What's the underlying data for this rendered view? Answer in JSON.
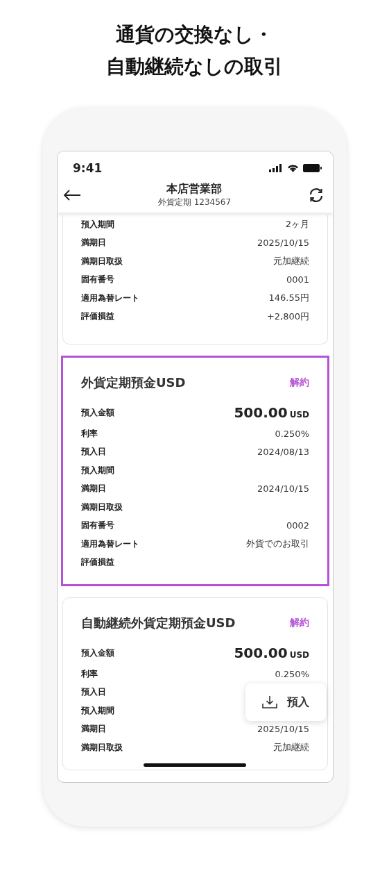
{
  "headline": [
    "通貨の交換なし・",
    "自動継続なしの取引"
  ],
  "status_bar": {
    "time": "9:41"
  },
  "nav": {
    "title": "本店営業部",
    "subtitle": "外貨定期 1234567"
  },
  "cards": [
    {
      "highlighted": false,
      "rows": [
        {
          "kind": "plain",
          "label": "預入期間",
          "value": "2ヶ月"
        },
        {
          "kind": "plain",
          "label": "満期日",
          "value": "2025/10/15"
        },
        {
          "kind": "plain",
          "label": "満期日取扱",
          "value": "元加継続"
        },
        {
          "kind": "plain",
          "label": "固有番号",
          "value": "0001"
        },
        {
          "kind": "plain",
          "label": "適用為替レート",
          "value": "146.55円"
        },
        {
          "kind": "plain",
          "label": "評価損益",
          "value": "+2,800円"
        }
      ]
    },
    {
      "highlighted": true,
      "title": "外貨定期預金USD",
      "action": "解約",
      "rows": [
        {
          "kind": "amount",
          "label": "預入金額",
          "value": "500.00",
          "unit": "USD"
        },
        {
          "kind": "plain",
          "label": "利率",
          "value": "0.250%"
        },
        {
          "kind": "plain",
          "label": "預入日",
          "value": "2024/08/13"
        },
        {
          "kind": "plain",
          "label": "預入期間"
        },
        {
          "kind": "plain",
          "label": "満期日",
          "value": "2024/10/15"
        },
        {
          "kind": "plain",
          "label": "満期日取扱"
        },
        {
          "kind": "plain",
          "label": "固有番号",
          "value": "0002"
        },
        {
          "kind": "plain",
          "label": "適用為替レート",
          "value": "外貨でのお取引"
        },
        {
          "kind": "plain",
          "label": "評価損益"
        }
      ]
    },
    {
      "highlighted": false,
      "title": "自動継続外貨定期預金USD",
      "action": "解約",
      "rows": [
        {
          "kind": "amount",
          "label": "預入金額",
          "value": "500.00",
          "unit": "USD"
        },
        {
          "kind": "plain",
          "label": "利率",
          "value": "0.250%"
        },
        {
          "kind": "plain",
          "label": "預入日"
        },
        {
          "kind": "plain",
          "label": "預入期間"
        },
        {
          "kind": "plain",
          "label": "満期日",
          "value": "2025/10/15"
        },
        {
          "kind": "plain",
          "label": "満期日取扱",
          "value": "元加継続"
        }
      ]
    }
  ],
  "fab": {
    "label": "預入"
  }
}
